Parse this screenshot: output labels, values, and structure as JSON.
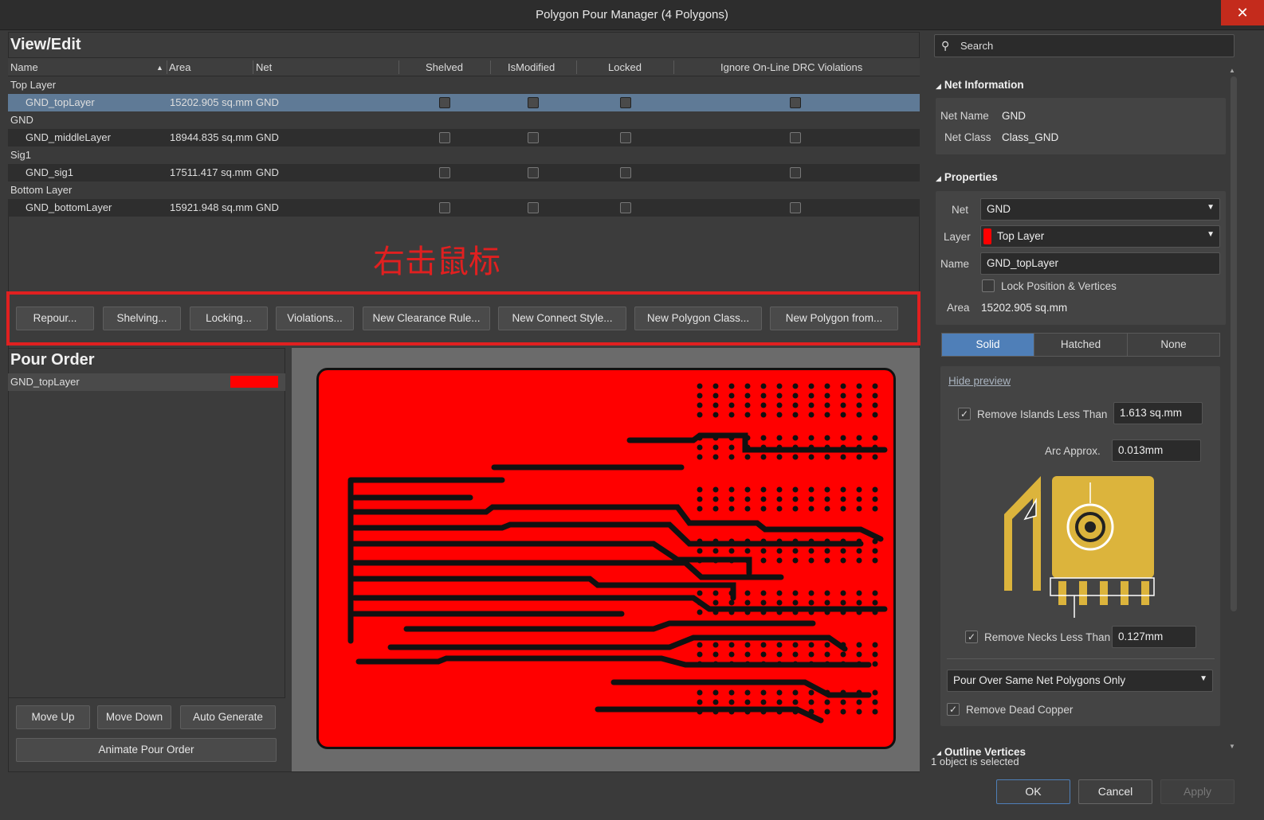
{
  "window": {
    "title": "Polygon Pour Manager (4 Polygons)",
    "close_glyph": "✕"
  },
  "view_edit": {
    "heading": "View/Edit",
    "columns": [
      "Name",
      "Area",
      "Net",
      "Shelved",
      "IsModified",
      "Locked",
      "Ignore On-Line DRC Violations"
    ],
    "groups": [
      {
        "label": "Top Layer",
        "item": {
          "name": "GND_topLayer",
          "area": "15202.905 sq.mm",
          "net": "GND",
          "selected": true
        }
      },
      {
        "label": "GND",
        "item": {
          "name": "GND_middleLayer",
          "area": "18944.835 sq.mm",
          "net": "GND",
          "selected": false
        }
      },
      {
        "label": "Sig1",
        "item": {
          "name": "GND_sig1",
          "area": "17511.417 sq.mm",
          "net": "GND",
          "selected": false
        }
      },
      {
        "label": "Bottom Layer",
        "item": {
          "name": "GND_bottomLayer",
          "area": "15921.948 sq.mm",
          "net": "GND",
          "selected": false
        }
      }
    ],
    "annotation": "右击鼠标",
    "actions": [
      "Repour...",
      "Shelving...",
      "Locking...",
      "Violations...",
      "New Clearance Rule...",
      "New Connect Style...",
      "New Polygon Class...",
      "New Polygon from..."
    ]
  },
  "pour_order": {
    "heading": "Pour Order",
    "items": [
      {
        "name": "GND_topLayer",
        "color": "#ff0000"
      }
    ],
    "buttons": {
      "move_up": "Move Up",
      "move_down": "Move Down",
      "auto_generate": "Auto Generate",
      "animate": "Animate Pour Order"
    }
  },
  "board_preview": {
    "fill_color": "#ff0000"
  },
  "inspector": {
    "search_placeholder": "Search",
    "net_info": {
      "heading": "Net Information",
      "net_name_label": "Net Name",
      "net_name": "GND",
      "net_class_label": "Net Class",
      "net_class": "Class_GND"
    },
    "properties": {
      "heading": "Properties",
      "net_label": "Net",
      "net": "GND",
      "layer_label": "Layer",
      "layer": "Top Layer",
      "layer_color": "#ff0000",
      "name_label": "Name",
      "name": "GND_topLayer",
      "lock_label": "Lock Position & Vertices",
      "area_label": "Area",
      "area": "15202.905 sq.mm"
    },
    "fill_modes": {
      "options": [
        "Solid",
        "Hatched",
        "None"
      ],
      "selected": "Solid"
    },
    "fill_options": {
      "hide_preview": "Hide preview",
      "remove_islands_label": "Remove Islands Less Than",
      "remove_islands_value": "1.613 sq.mm",
      "arc_approx_label": "Arc Approx.",
      "arc_approx_value": "0.013mm",
      "remove_necks_label": "Remove Necks Less Than",
      "remove_necks_value": "0.127mm",
      "pour_over": "Pour Over Same Net Polygons Only",
      "remove_dead_copper": "Remove Dead Copper",
      "diagram_color": "#dcb43c"
    },
    "outline_heading": "Outline Vertices"
  },
  "status": "1 object is selected",
  "dialog_buttons": {
    "ok": "OK",
    "cancel": "Cancel",
    "apply": "Apply"
  },
  "colors": {
    "selection": "#5f7a96",
    "highlight_red": "#e02020",
    "accent_blue": "#4f7fb8"
  }
}
